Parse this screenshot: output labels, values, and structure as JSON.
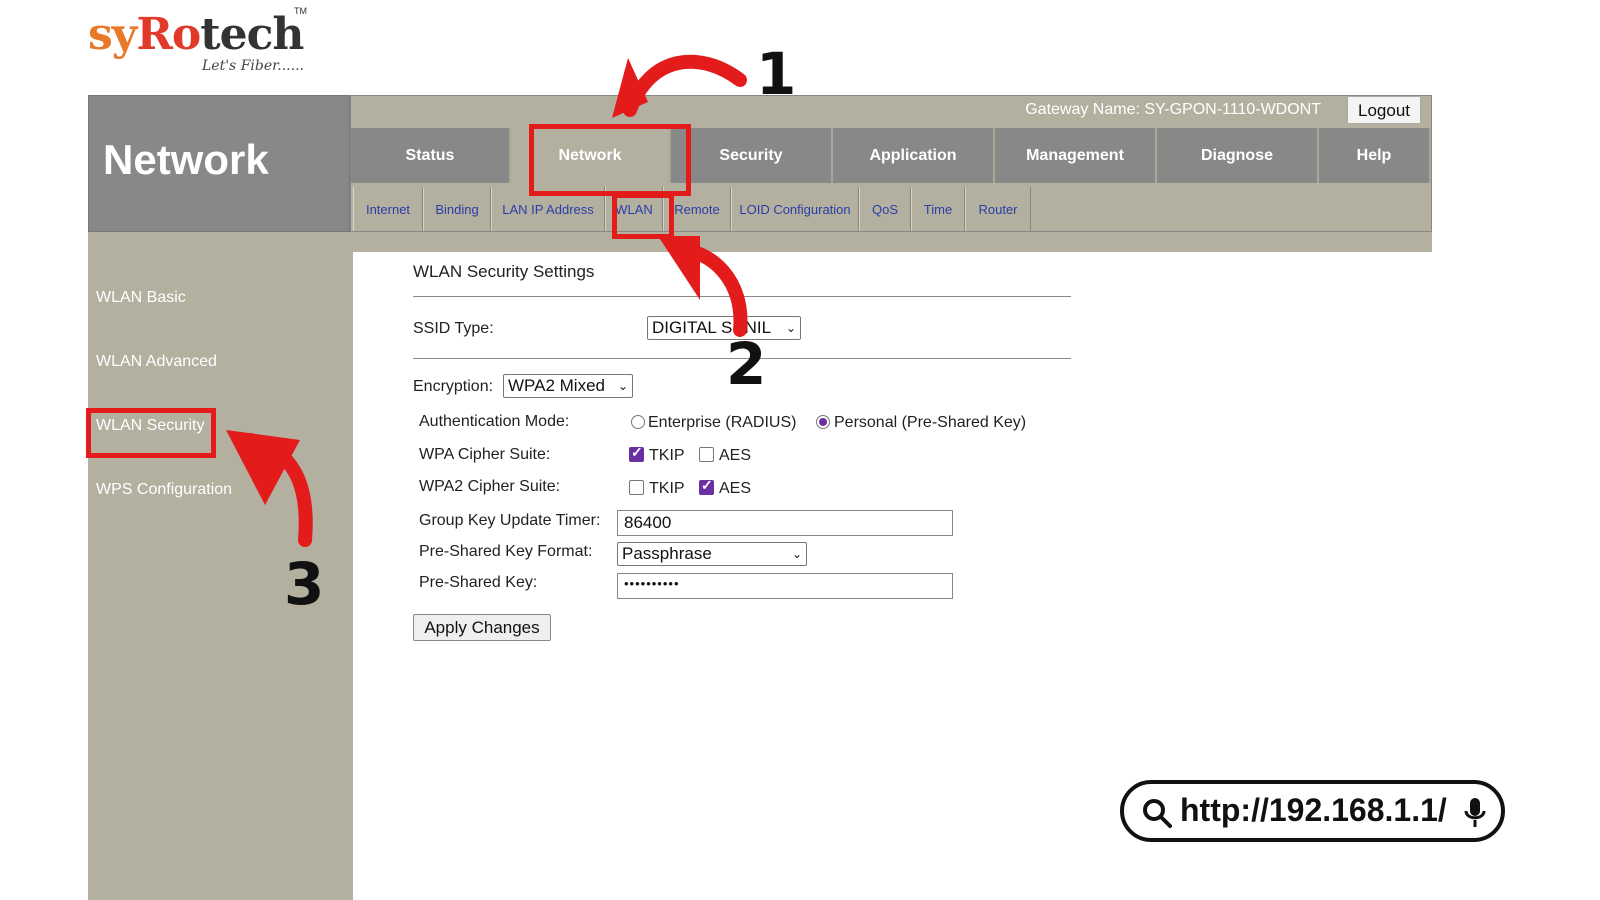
{
  "logo": {
    "brand_sy": "sy",
    "brand_ro": "Ro",
    "brand_tech": "tech",
    "tagline": "Let's Fiber......",
    "tm": "TM"
  },
  "header": {
    "page_title": "Network",
    "gateway_name": "Gateway Name: SY-GPON-1110-WDONT",
    "logout_label": "Logout"
  },
  "main_tabs": [
    {
      "label": "Status",
      "active": false
    },
    {
      "label": "Network",
      "active": true
    },
    {
      "label": "Security",
      "active": false
    },
    {
      "label": "Application",
      "active": false
    },
    {
      "label": "Management",
      "active": false
    },
    {
      "label": "Diagnose",
      "active": false
    },
    {
      "label": "Help",
      "active": false
    }
  ],
  "sub_tabs": [
    {
      "label": "Internet"
    },
    {
      "label": "Binding"
    },
    {
      "label": "LAN IP Address"
    },
    {
      "label": "WLAN"
    },
    {
      "label": "Remote"
    },
    {
      "label": "LOID Configuration"
    },
    {
      "label": "QoS"
    },
    {
      "label": "Time"
    },
    {
      "label": "Router"
    }
  ],
  "sidebar": {
    "items": [
      {
        "label": "WLAN Basic"
      },
      {
        "label": "WLAN Advanced"
      },
      {
        "label": "WLAN Security"
      },
      {
        "label": "WPS Configuration"
      }
    ]
  },
  "form": {
    "section_title": "WLAN Security Settings",
    "ssid_type_label": "SSID Type:",
    "ssid_type_value": "DIGITAL SUNIL",
    "encryption_label": "Encryption:",
    "encryption_value": "WPA2 Mixed",
    "auth_mode_label": "Authentication Mode:",
    "auth_enterprise": "Enterprise (RADIUS)",
    "auth_personal": "Personal (Pre-Shared Key)",
    "wpa_cipher_label": "WPA Cipher Suite:",
    "wpa2_cipher_label": "WPA2 Cipher Suite:",
    "tkip": "TKIP",
    "aes": "AES",
    "group_key_label": "Group Key Update Timer:",
    "group_key_value": "86400",
    "psk_format_label": "Pre-Shared Key Format:",
    "psk_format_value": "Passphrase",
    "psk_label": "Pre-Shared Key:",
    "psk_value": "••••••••••",
    "apply_label": "Apply Changes"
  },
  "annotations": {
    "step1": "1",
    "step2": "2",
    "step3": "3",
    "highlight_color": "#e31b1b"
  },
  "urlbar": {
    "url": "http://192.168.1.1/"
  },
  "colors": {
    "header_gray": "#888888",
    "tan": "#b3b0a0",
    "link_blue": "#2b3ea8",
    "accent_purple": "#6a2fa0"
  }
}
